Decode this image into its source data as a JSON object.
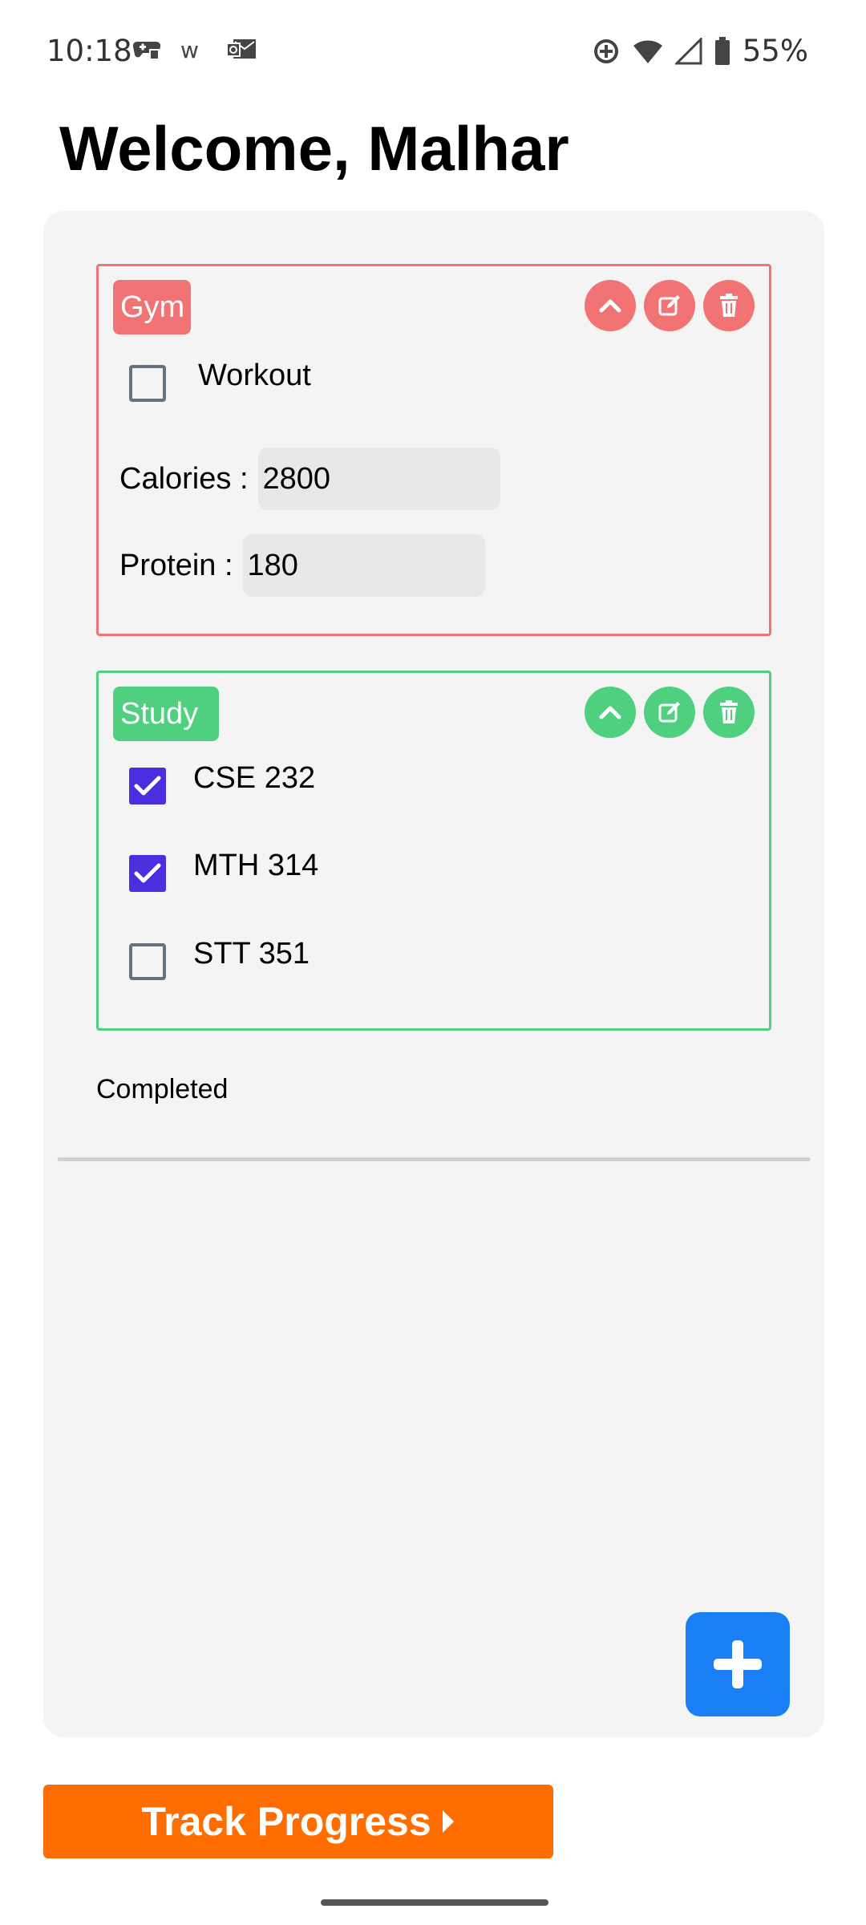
{
  "status": {
    "time": "10:18",
    "battery": "55%",
    "left_icons": [
      "game-controller-icon",
      "w-icon",
      "mail-badge-icon"
    ],
    "right_icons": [
      "data-saver-icon",
      "wifi-icon",
      "signal-icon",
      "battery-icon"
    ]
  },
  "header": {
    "welcome": "Welcome, Malhar"
  },
  "cards": [
    {
      "tag": "Gym",
      "color": "#f27373",
      "tasks": [
        {
          "label": "Workout",
          "checked": false
        }
      ],
      "fields": [
        {
          "label": "Calories :",
          "value": "2800"
        },
        {
          "label": "Protein :",
          "value": "180"
        }
      ],
      "actions": [
        "collapse-icon",
        "edit-icon",
        "delete-icon"
      ]
    },
    {
      "tag": "Study",
      "color": "#4ed07e",
      "tasks": [
        {
          "label": "CSE 232",
          "checked": true
        },
        {
          "label": "MTH 314",
          "checked": true
        },
        {
          "label": "STT 351",
          "checked": false
        }
      ],
      "actions": [
        "collapse-icon",
        "edit-icon",
        "delete-icon"
      ]
    }
  ],
  "completed": {
    "label": "Completed"
  },
  "fab": {
    "icon": "plus-icon",
    "color": "#1a7ff5"
  },
  "track": {
    "label": "Track Progress",
    "icon": "caret-right-icon",
    "color": "#ff6d00"
  }
}
